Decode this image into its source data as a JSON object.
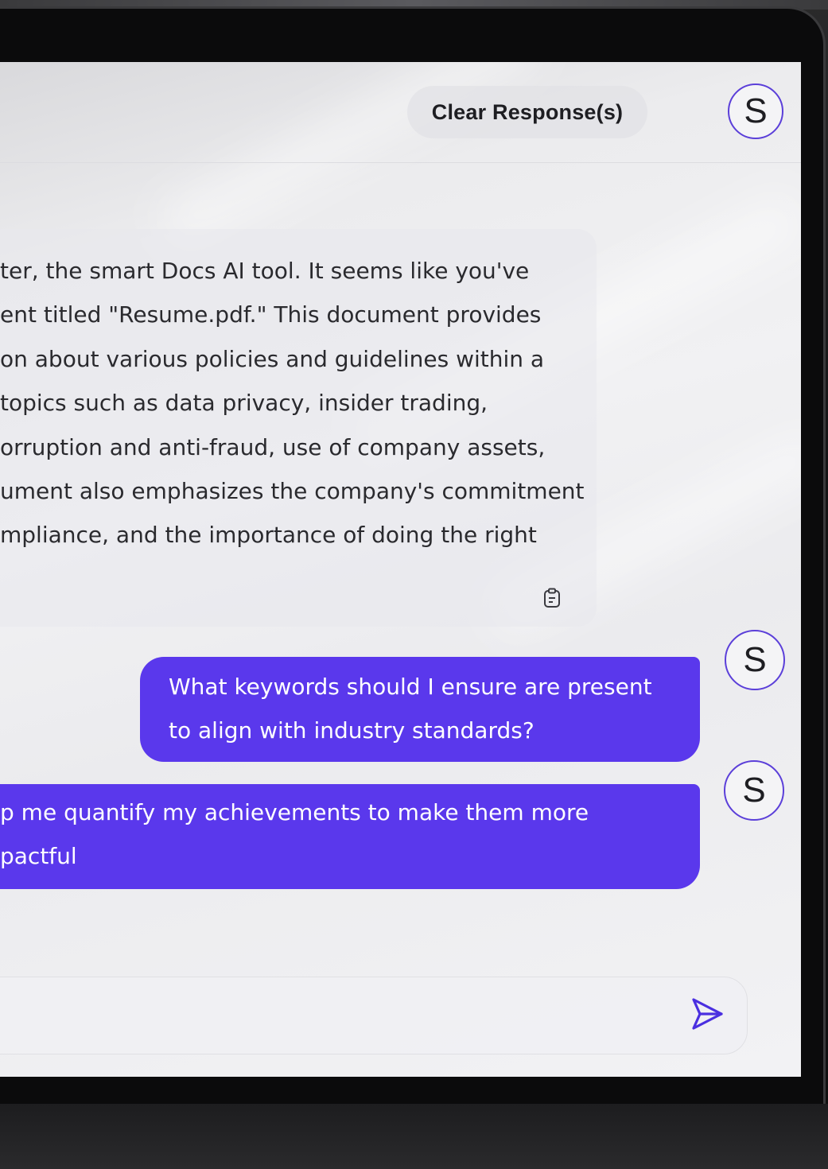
{
  "header": {
    "clear_button_label": "Clear Response(s)",
    "avatar_initial": "S"
  },
  "messages": {
    "ai_response": {
      "lines": [
        "ter, the smart Docs AI tool. It seems like you've",
        "ent titled \"Resume.pdf.\" This document provides",
        "on about various policies and guidelines within a",
        " topics such as data privacy, insider trading,",
        "orruption and anti-fraud, use of company assets,",
        "ument also emphasizes the company's commitment",
        "mpliance, and the importance of doing the right"
      ],
      "copy_icon": "clipboard-icon"
    },
    "user_1": {
      "avatar_initial": "S",
      "lines": [
        "What keywords should I ensure are present",
        "to align with industry standards?"
      ]
    },
    "user_2": {
      "avatar_initial": "S",
      "lines": [
        "p me quantify my achievements to make them more",
        "pactful"
      ]
    }
  },
  "composer": {
    "send_icon": "send-icon"
  },
  "colors": {
    "accent": "#5a38ec",
    "avatar_ring": "#5b3fd9",
    "screen_bg": "#ececee",
    "bezel": "#0b0b0c"
  }
}
